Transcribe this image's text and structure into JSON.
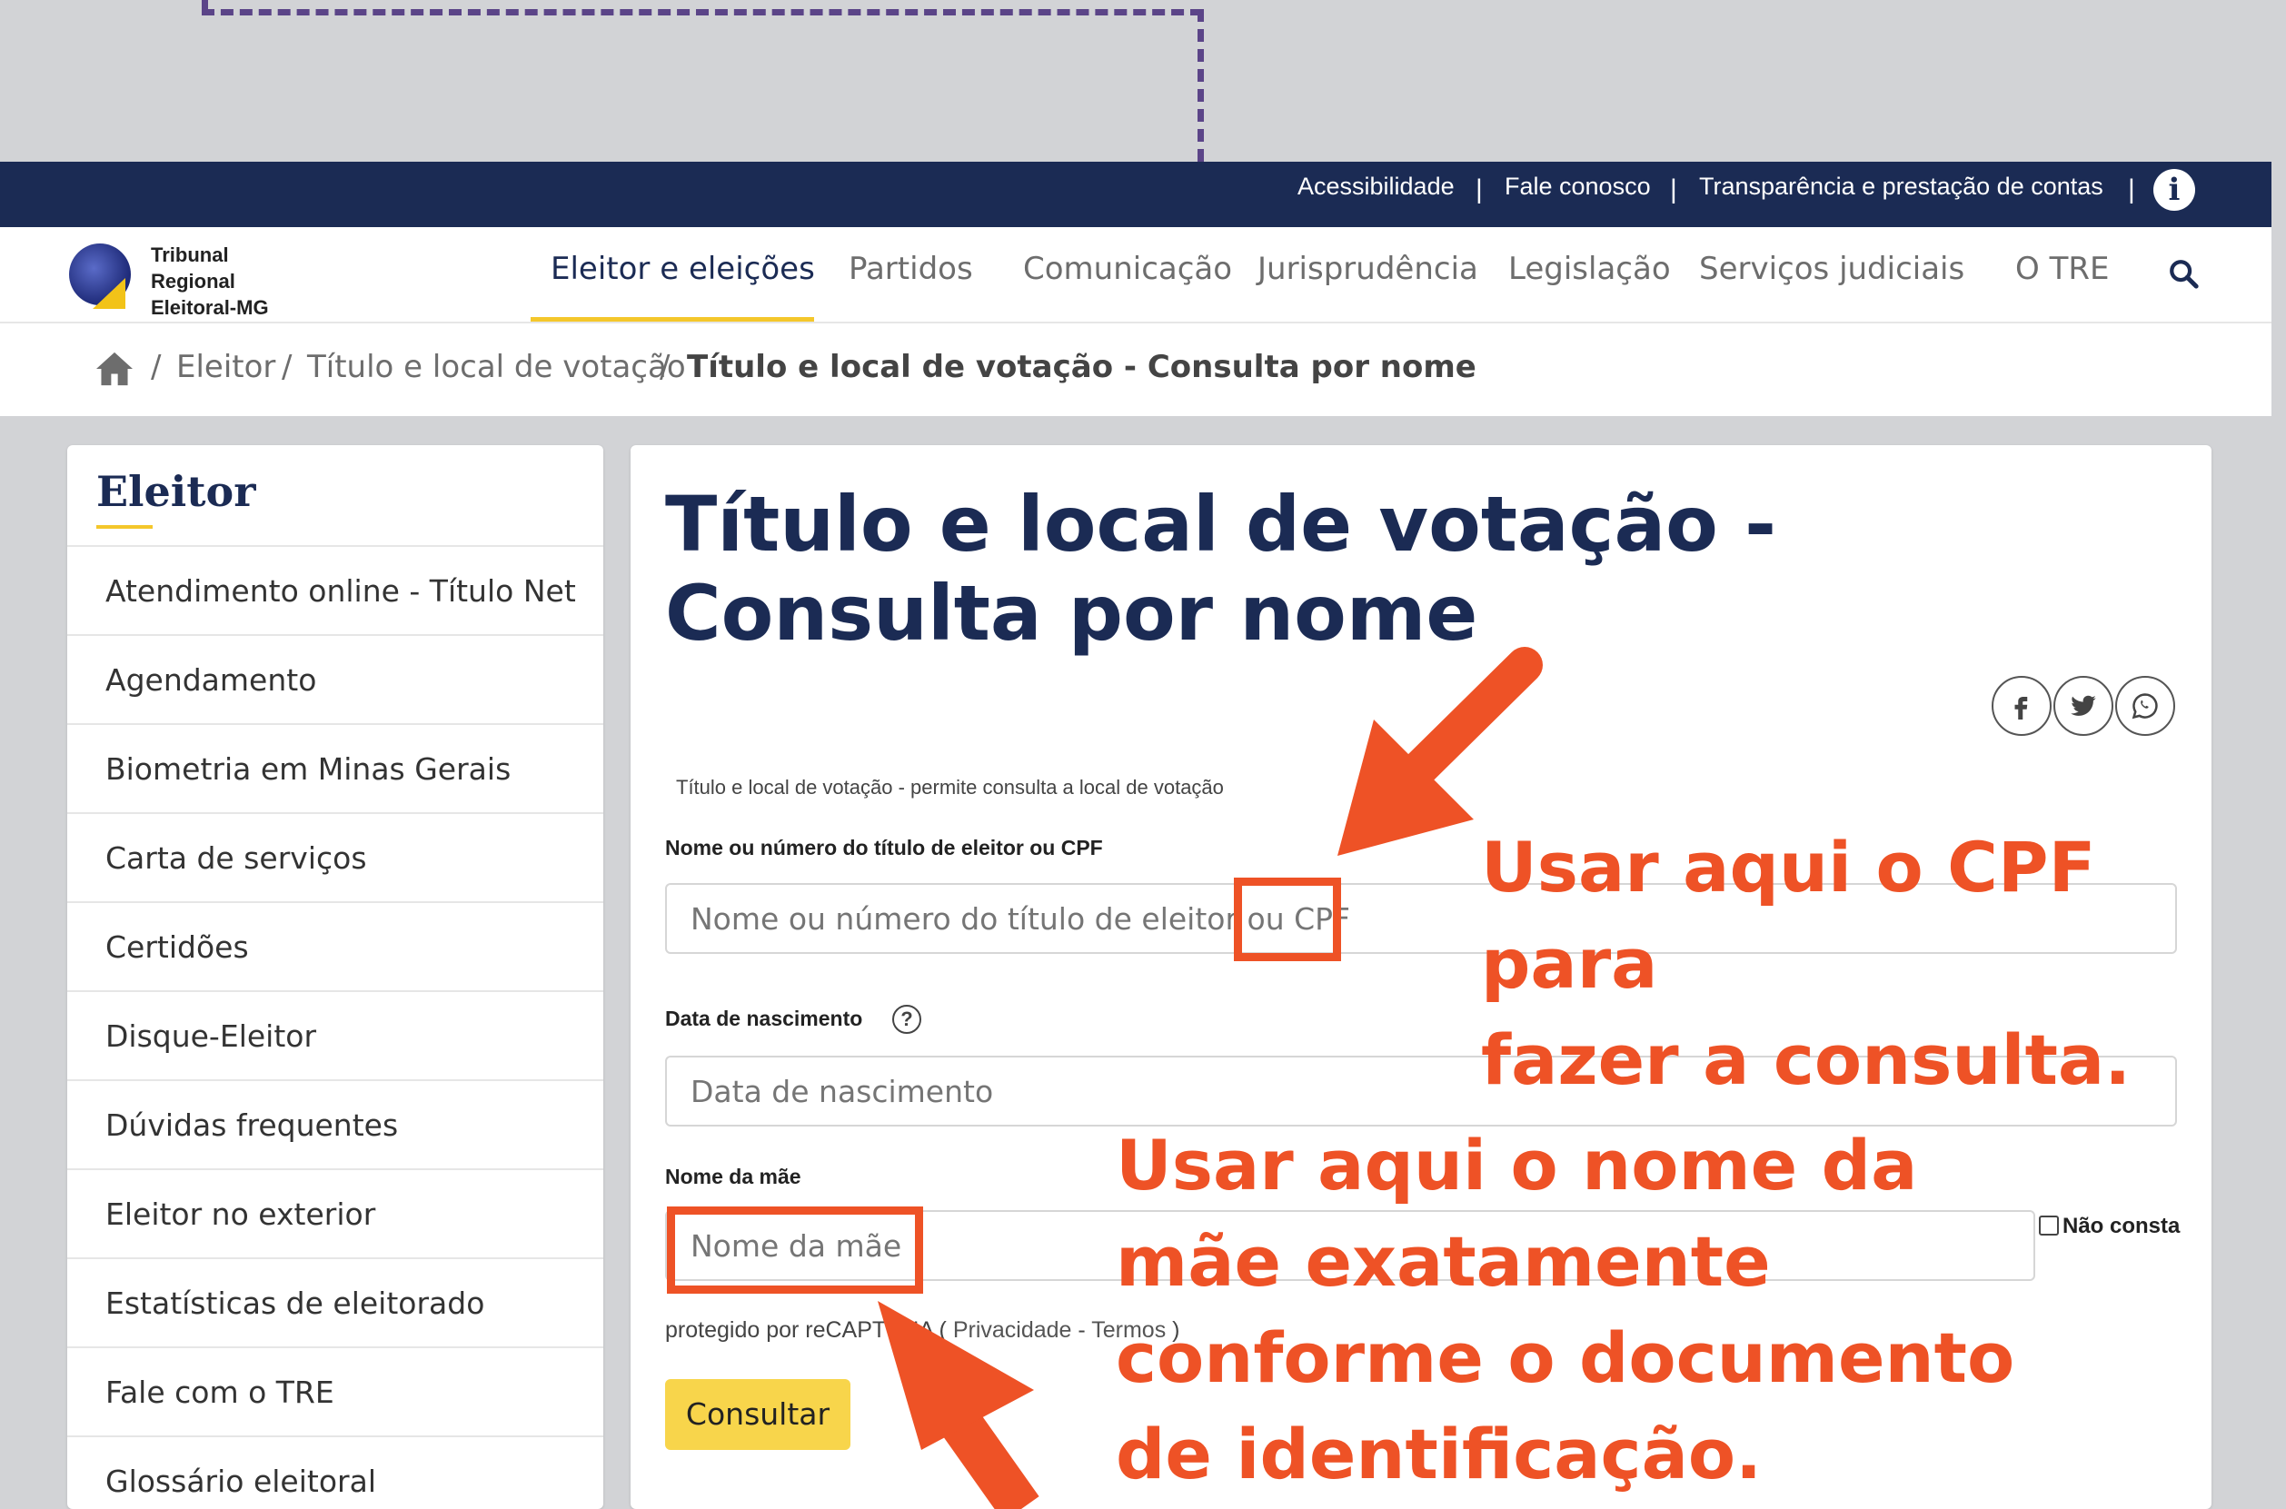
{
  "topbar": {
    "links": [
      "Acessibilidade",
      "Fale conosco",
      "Transparência e prestação de contas"
    ],
    "separator": "|",
    "info_glyph": "i"
  },
  "logo": {
    "line1": "Tribunal",
    "line2": "Regional",
    "line3": "Eleitoral-MG"
  },
  "nav": {
    "items": [
      "Eleitor e eleições",
      "Partidos",
      "Comunicação",
      "Jurisprudência",
      "Legislação",
      "Serviços judiciais",
      "O TRE"
    ],
    "active_index": 0
  },
  "breadcrumb": {
    "items": [
      "Eleitor",
      "Título e local de votação",
      "Título e local de votação - Consulta por nome"
    ],
    "separator": "/"
  },
  "sidebar": {
    "title": "Eleitor",
    "items": [
      "Atendimento online - Título Net",
      "Agendamento",
      "Biometria em Minas Gerais",
      "Carta de serviços",
      "Certidões",
      "Disque-Eleitor",
      "Dúvidas frequentes",
      "Eleitor no exterior",
      "Estatísticas de eleitorado",
      "Fale com o TRE",
      "Glossário eleitoral"
    ]
  },
  "main": {
    "title": "Título e local de votação - Consulta por nome",
    "share": [
      "facebook-icon",
      "twitter-icon",
      "whatsapp-icon"
    ],
    "description": "Título e local de votação - permite consulta a local de votação",
    "fields": {
      "name": {
        "label": "Nome ou número do título de eleitor ou CPF",
        "placeholder": "Nome ou número do título de eleitor ou CPF"
      },
      "birth": {
        "label": "Data de nascimento",
        "placeholder": "Data de nascimento",
        "help_glyph": "?"
      },
      "mother": {
        "label": "Nome da mãe",
        "placeholder": "Nome da mãe",
        "checkbox_label": "Não consta",
        "checked": false
      }
    },
    "recaptcha": {
      "prefix": "protegido por reCAPTCHA (",
      "privacy": "Privacidade",
      "dash": "-",
      "terms": "Termos",
      "suffix": ")"
    },
    "submit_label": "Consultar"
  },
  "annotations": {
    "accent": "#ee5226",
    "cpf_note_line1": "Usar aqui o CPF para",
    "cpf_note_line2": "fazer a consulta.",
    "mother_note_line1": "Usar aqui o nome da",
    "mother_note_line2": "mãe exatamente",
    "mother_note_line3": "conforme o documento",
    "mother_note_line4": "de identificação."
  },
  "colors": {
    "navy": "#1b2b54",
    "yellow": "#f4c72b",
    "button": "#f8d54b",
    "annotation": "#ee5226",
    "dash": "#5b4488"
  }
}
